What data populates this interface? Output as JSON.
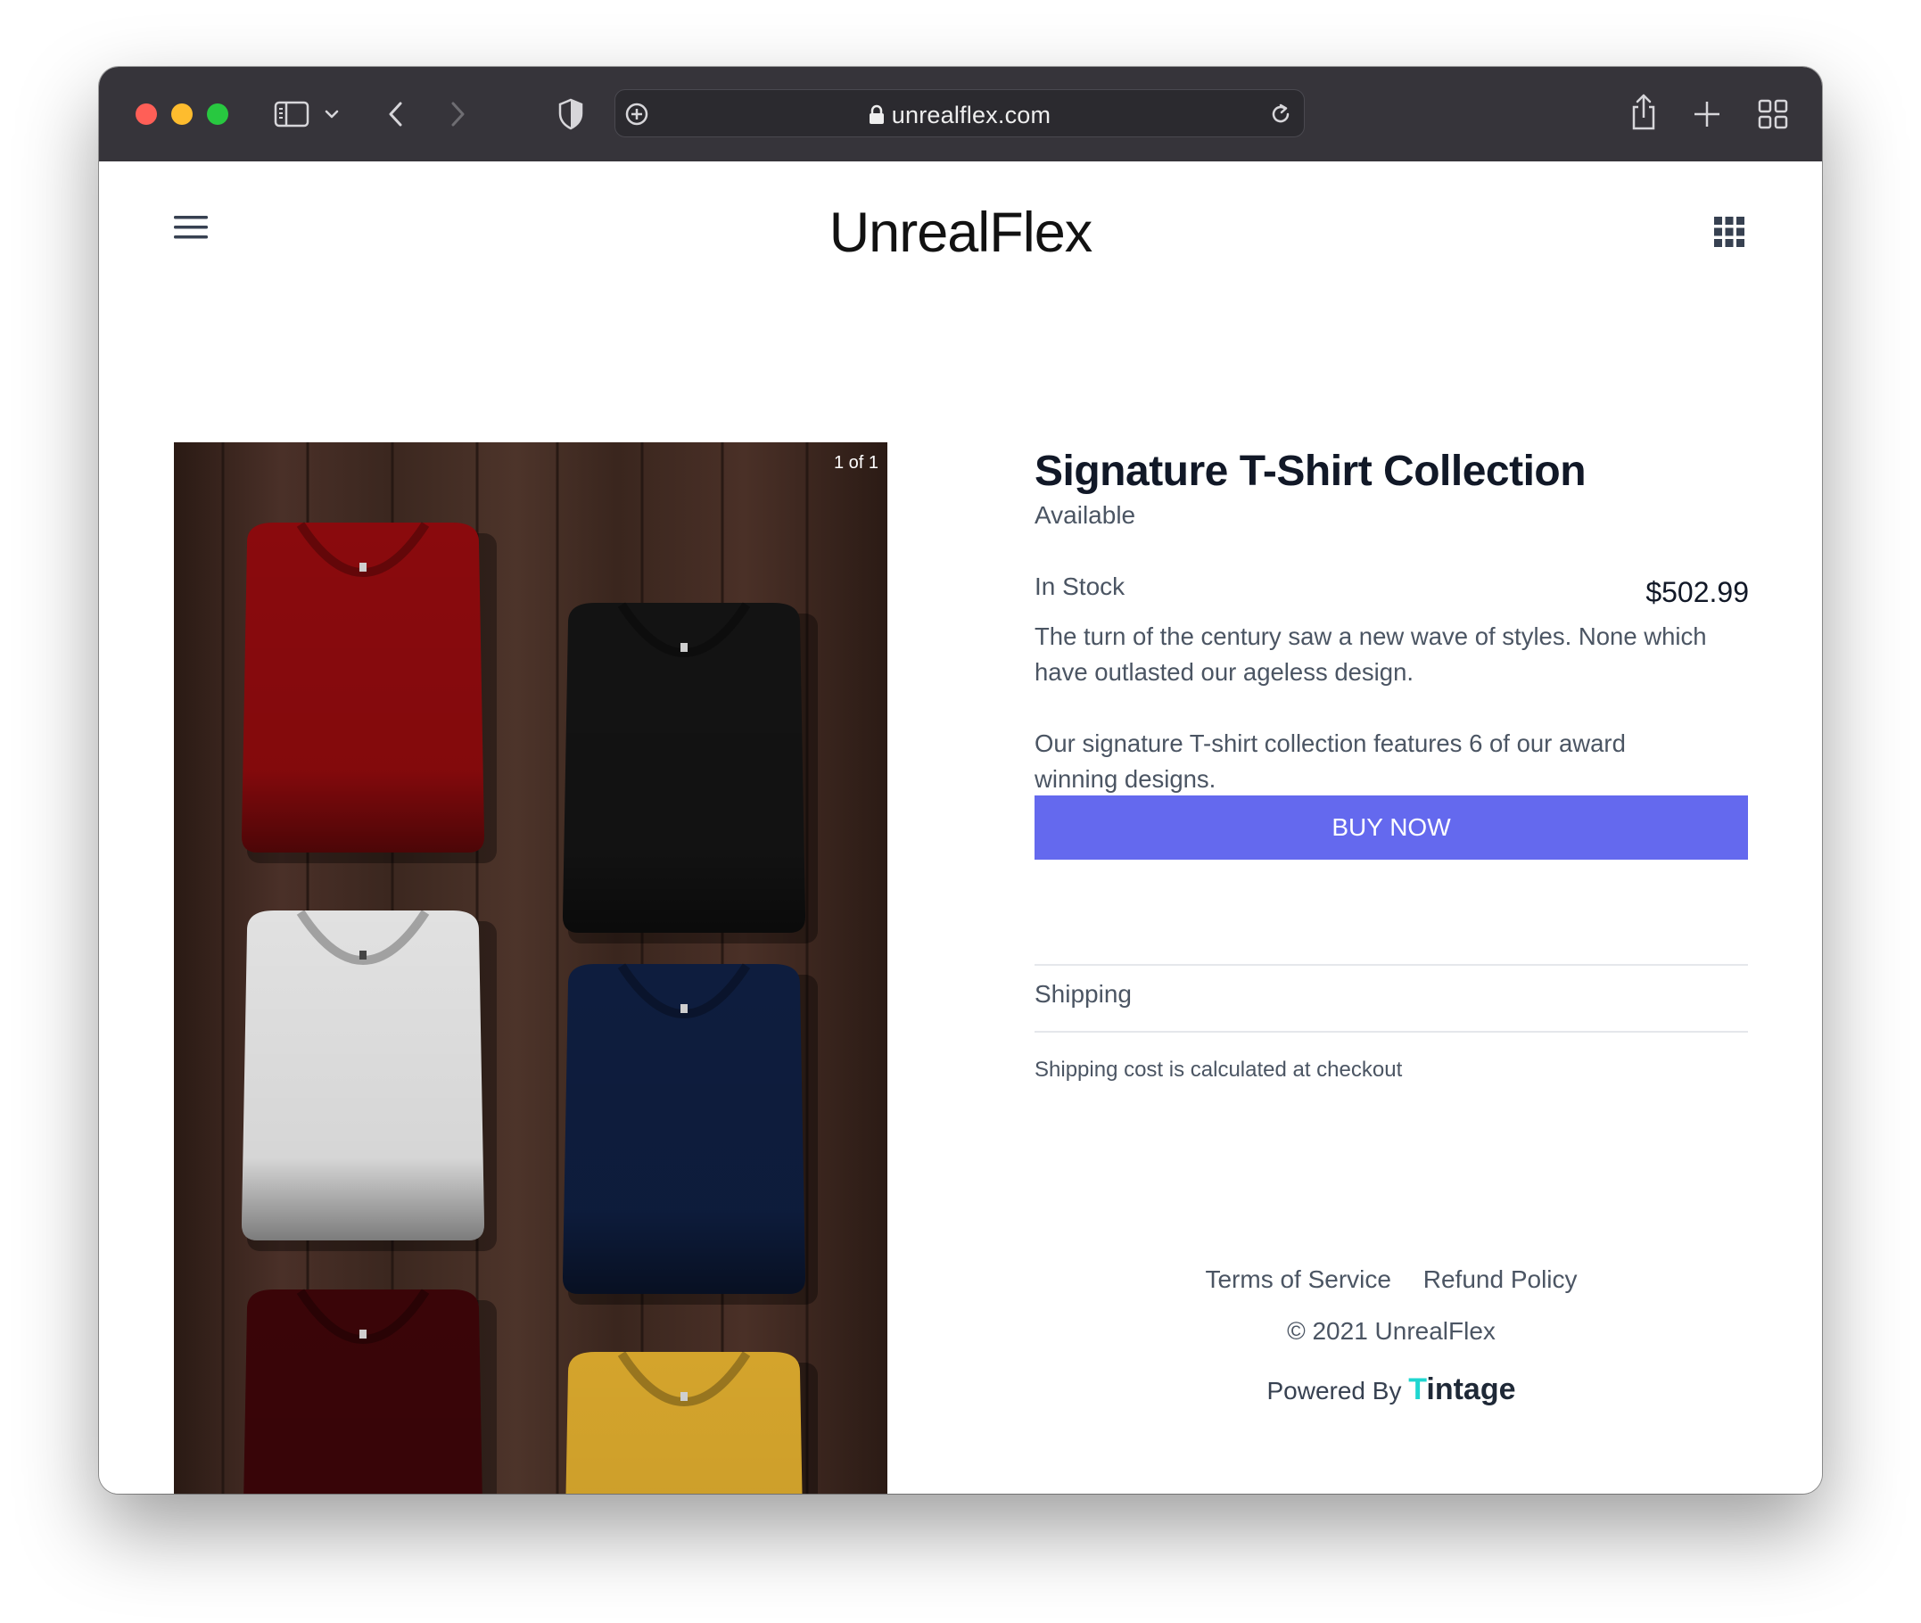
{
  "browser": {
    "url": "unrealflex.com",
    "colors": {
      "close": "#ff5f57",
      "minimize": "#febc2e",
      "zoom": "#28c840"
    },
    "icons": [
      "sidebar-icon",
      "chevron-down-icon",
      "back-icon",
      "forward-icon",
      "shield-icon",
      "extension-icon",
      "lock-icon",
      "reload-icon",
      "share-icon",
      "new-tab-icon",
      "tab-overview-icon"
    ]
  },
  "site": {
    "brand": "UnrealFlex",
    "menu_icon": "hamburger-icon",
    "apps_icon": "grid-icon"
  },
  "gallery": {
    "counter": "1 of 1",
    "shirt_colors": [
      "#8a0a0d",
      "#131313",
      "#e1e1e1",
      "#0e1d3e",
      "#3a0508",
      "#d4a42c"
    ]
  },
  "product": {
    "title": "Signature T-Shirt Collection",
    "availability": "Available",
    "stock": "In Stock",
    "price": "$502.99",
    "description": [
      "The turn of the century saw a new wave of styles. None which have outlasted our ageless design.",
      "Our signature T-shirt collection features 6 of our award winning designs."
    ],
    "buy_label": "BUY NOW",
    "accent": "#6469ee"
  },
  "shipping": {
    "heading": "Shipping",
    "text": "Shipping cost is calculated at checkout"
  },
  "footer": {
    "terms": "Terms of Service",
    "refund": "Refund Policy",
    "copyright": "© 2021 UnrealFlex",
    "powered_by": "Powered By",
    "powered_first": "T",
    "powered_rest": "intage"
  }
}
